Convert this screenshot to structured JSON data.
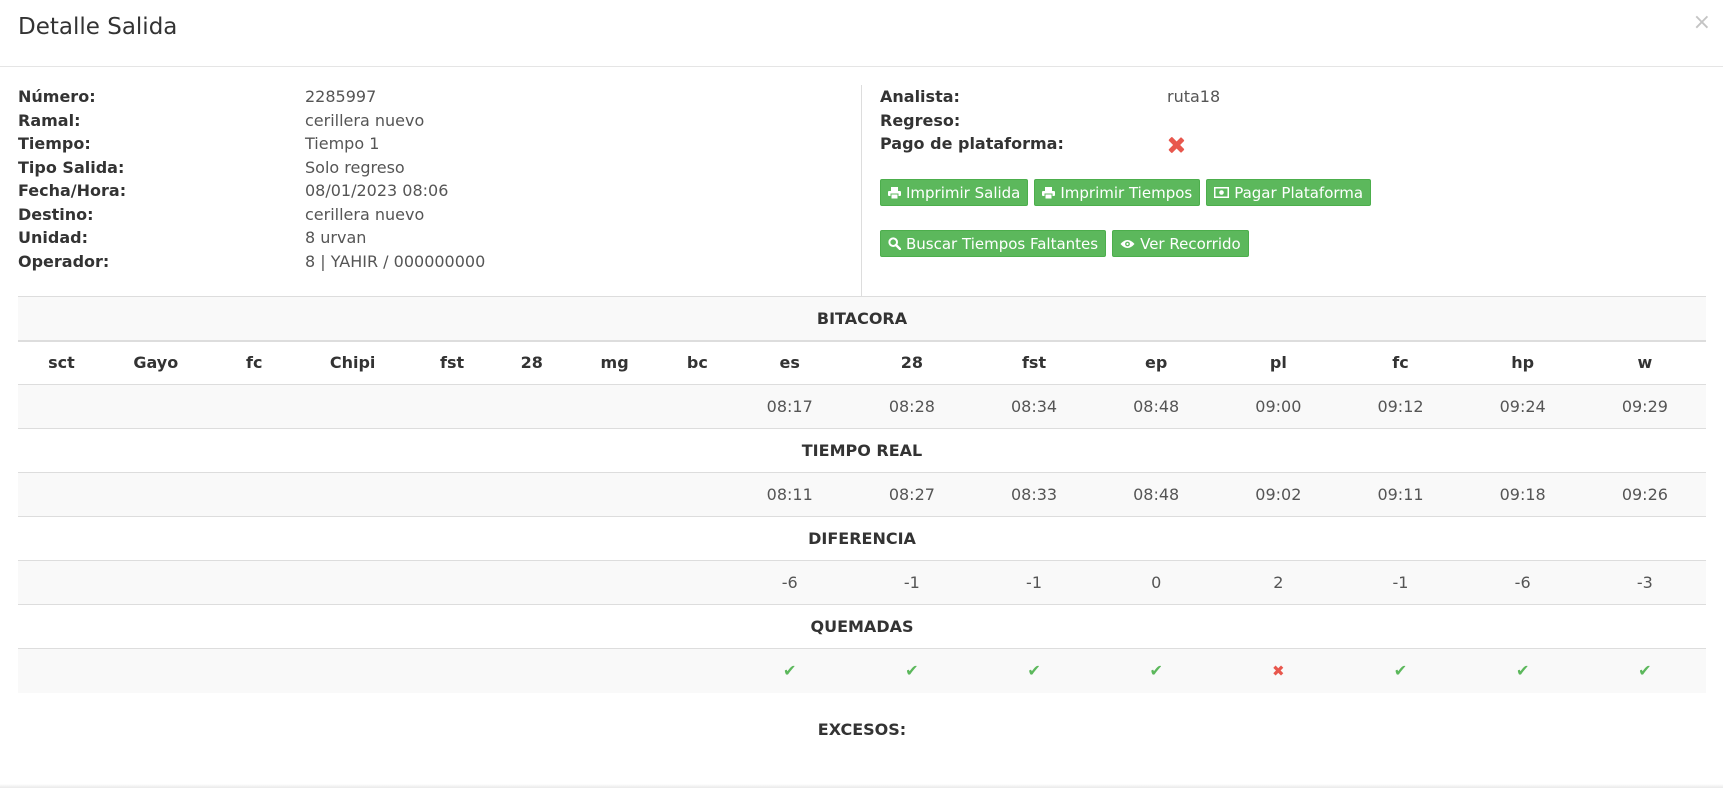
{
  "modal": {
    "title": "Detalle Salida",
    "close_label": "×"
  },
  "info_left": [
    {
      "label": "Número:",
      "value": "2285997"
    },
    {
      "label": "Ramal:",
      "value": "cerillera nuevo"
    },
    {
      "label": "Tiempo:",
      "value": "Tiempo 1"
    },
    {
      "label": "Tipo Salida:",
      "value": "Solo regreso"
    },
    {
      "label": "Fecha/Hora:",
      "value": "08/01/2023 08:06"
    },
    {
      "label": "Destino:",
      "value": "cerillera nuevo"
    },
    {
      "label": "Unidad:",
      "value": "8 urvan"
    },
    {
      "label": "Operador:",
      "value": "8 | YAHIR / 000000000"
    }
  ],
  "info_right": {
    "analista_label": "Analista:",
    "analista_value": "ruta18",
    "regreso_label": "Regreso:",
    "regreso_value": "",
    "pago_label": "Pago de plataforma:",
    "pago_status_icon": "cross-icon",
    "status_colors": {
      "ok": "#5cb85c",
      "fail": "#e8574d"
    }
  },
  "buttons": {
    "imprimir_salida": "Imprimir Salida",
    "imprimir_tiempos": "Imprimir Tiempos",
    "pagar_plataforma": "Pagar Plataforma",
    "buscar_tiempos": "Buscar Tiempos Faltantes",
    "ver_recorrido": "Ver Recorrido",
    "accent_color": "#5cb85c"
  },
  "table": {
    "bitacora_title": "BITACORA",
    "columns": [
      "sct",
      "Gayo",
      "fc",
      "Chipi",
      "fst",
      "28",
      "mg",
      "bc",
      "es",
      "28",
      "fst",
      "ep",
      "pl",
      "fc",
      "hp",
      "w"
    ],
    "bitacora": [
      "",
      "",
      "",
      "",
      "",
      "",
      "",
      "",
      "08:17",
      "08:28",
      "08:34",
      "08:48",
      "09:00",
      "09:12",
      "09:24",
      "09:29"
    ],
    "tiempo_real_title": "TIEMPO REAL",
    "tiempo_real": [
      "",
      "",
      "",
      "",
      "",
      "",
      "",
      "",
      "08:11",
      "08:27",
      "08:33",
      "08:48",
      "09:02",
      "09:11",
      "09:18",
      "09:26"
    ],
    "diferencia_title": "DIFERENCIA",
    "diferencia": [
      "",
      "",
      "",
      "",
      "",
      "",
      "",
      "",
      "-6",
      "-1",
      "-1",
      "0",
      "2",
      "-1",
      "-6",
      "-3"
    ],
    "quemadas_title": "QUEMADAS",
    "quemadas": [
      "",
      "",
      "",
      "",
      "",
      "",
      "",
      "",
      "check",
      "check",
      "check",
      "check",
      "cross",
      "check",
      "check",
      "check"
    ]
  },
  "excesos_label": "EXCESOS:"
}
